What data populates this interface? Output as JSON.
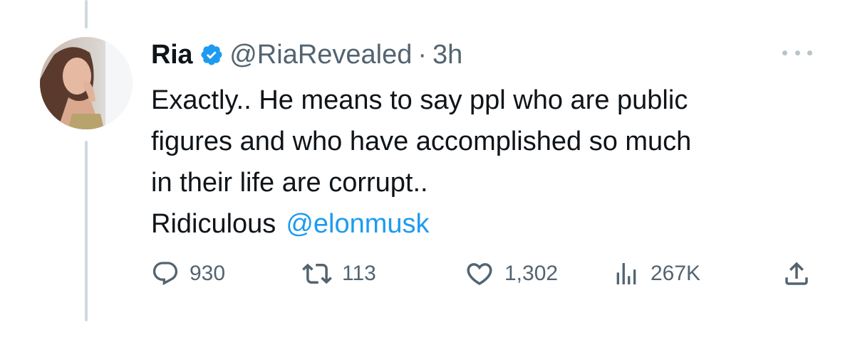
{
  "tweet": {
    "display_name": "Ria",
    "verified": true,
    "handle": "@RiaRevealed",
    "separator": "·",
    "time": "3h",
    "body_lines": [
      "Exactly.. He means to say ppl who are public",
      "figures and who have accomplished so much",
      "in their life are corrupt.."
    ],
    "last_line_text": "Ridiculous",
    "mention": "@elonmusk"
  },
  "actions": {
    "replies": "930",
    "retweets": "113",
    "likes": "1,302",
    "views": "267K"
  },
  "icons": {
    "verified": "verified-badge-icon",
    "more": "more-options-icon",
    "reply": "reply-icon",
    "retweet": "retweet-icon",
    "like": "heart-icon",
    "views": "views-icon",
    "share": "share-icon"
  },
  "colors": {
    "accent": "#1d9bf0",
    "text": "#0f1419",
    "secondary": "#536471",
    "thread_line": "#cfd9de"
  }
}
